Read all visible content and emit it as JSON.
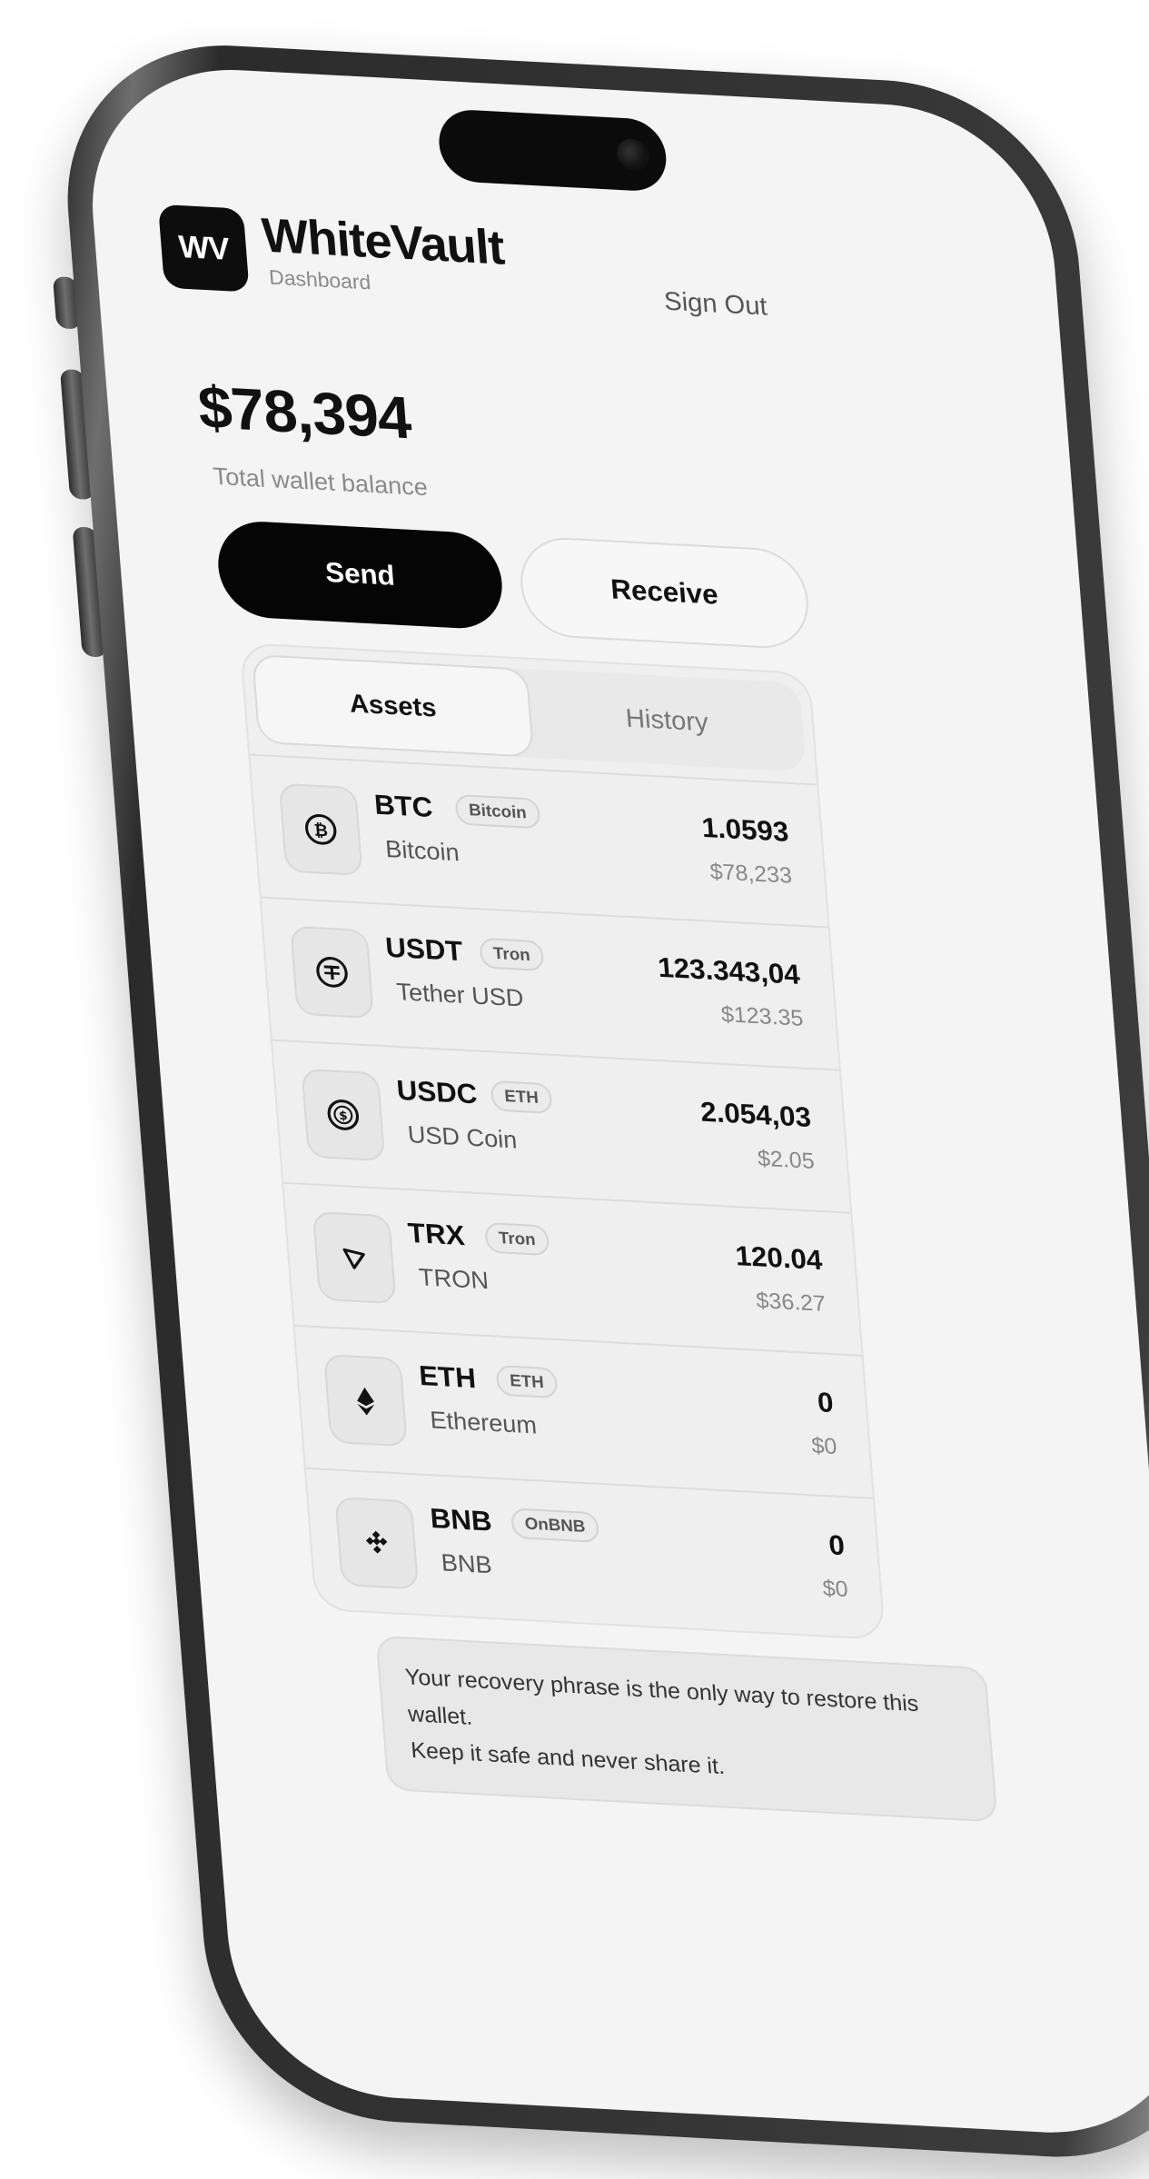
{
  "app": {
    "logo_text": "WV",
    "name": "WhiteVault",
    "subtitle": "Dashboard",
    "sign_out": "Sign Out"
  },
  "wallet": {
    "balance": "$78,394",
    "balance_label": "Total wallet balance"
  },
  "actions": {
    "send": "Send",
    "receive": "Receive"
  },
  "tabs": [
    {
      "label": "Assets",
      "active": true
    },
    {
      "label": "History",
      "active": false
    }
  ],
  "assets": [
    {
      "symbol": "BTC",
      "network": "Bitcoin",
      "name": "Bitcoin",
      "amount": "1.0593",
      "value": "$78,233",
      "icon": "bitcoin-icon"
    },
    {
      "symbol": "USDT",
      "network": "Tron",
      "name": "Tether USD",
      "amount": "123.343,04",
      "value": "$123.35",
      "icon": "tether-icon"
    },
    {
      "symbol": "USDC",
      "network": "ETH",
      "name": "USD Coin",
      "amount": "2.054,03",
      "value": "$2.05",
      "icon": "usd-coin-icon"
    },
    {
      "symbol": "TRX",
      "network": "Tron",
      "name": "TRON",
      "amount": "120.04",
      "value": "$36.27",
      "icon": "tron-icon"
    },
    {
      "symbol": "ETH",
      "network": "ETH",
      "name": "Ethereum",
      "amount": "0",
      "value": "$0",
      "icon": "ethereum-icon"
    },
    {
      "symbol": "BNB",
      "network": "OnBNB",
      "name": "BNB",
      "amount": "0",
      "value": "$0",
      "icon": "bnb-icon"
    }
  ],
  "notice": {
    "line1": "Your recovery phrase is the only way to restore this wallet.",
    "line2": "Keep it safe and never share it."
  },
  "colors": {
    "screen_bg": "#f4f4f4",
    "accent": "#050505",
    "frame": "#3a3a3a"
  }
}
